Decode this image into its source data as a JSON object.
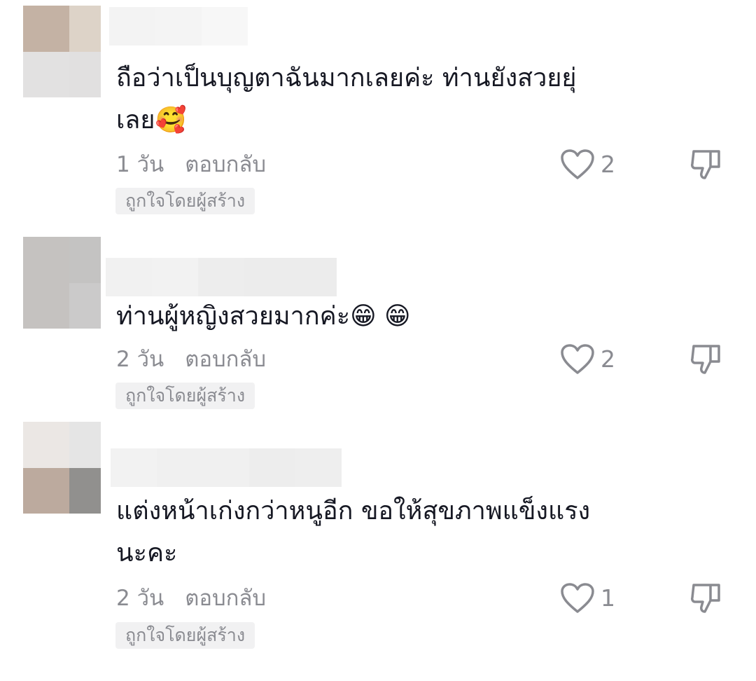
{
  "comments": [
    {
      "text": "ถือว่าเป็นบุญตาฉันมากเลยค่ะ ท่านยังสวยยุ่\nเลย🥰",
      "time": "1 วัน",
      "reply_label": "ตอบกลับ",
      "badge": "ถูกใจโดยผู้สร้าง",
      "likes": "2",
      "avatar_colors": [
        "#c4b2a4",
        "#ddd3c8",
        "#e2e1e1",
        "#e1e0e0"
      ],
      "username_colors": [
        "#f3f3f3",
        "#f4f4f4",
        "#f7f7f7"
      ]
    },
    {
      "text": "ท่านผู้หญิงสวยมากค่ะ😁 😁",
      "time": "2 วัน",
      "reply_label": "ตอบกลับ",
      "badge": "ถูกใจโดยผู้สร้าง",
      "likes": "2",
      "avatar_colors": [
        "#c5c2c0",
        "#c4c3c2",
        "#c5c2c0",
        "#cbcaca"
      ],
      "username_colors": [
        "#f1f1f1",
        "#f2f2f2",
        "#ededed",
        "#ececec"
      ]
    },
    {
      "text": "แต่งหน้าเก่งกว่าหนูอีก ขอให้สุขภาพแข็งแรง\nนะคะ",
      "time": "2 วัน",
      "reply_label": "ตอบกลับ",
      "badge": "ถูกใจโดยผู้สร้าง",
      "likes": "1",
      "avatar_colors": [
        "#ebe7e4",
        "#e5e5e5",
        "#bcaa9e",
        "#91908e"
      ],
      "username_colors": [
        "#f2f2f2",
        "#f0f0f0",
        "#ededed",
        "#eeeeee"
      ]
    }
  ],
  "icons": {
    "like": "heart-outline-icon",
    "dislike": "thumbs-down-outline-icon"
  },
  "colors": {
    "text": "#161823",
    "secondary_text": "#8a8b91",
    "badge_bg": "#f1f1f2",
    "icon_stroke": "#8a8b91"
  }
}
